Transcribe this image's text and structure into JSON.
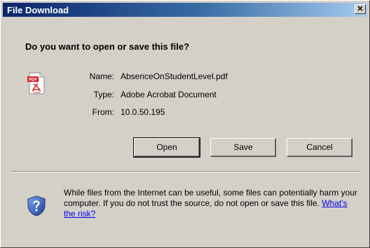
{
  "window": {
    "title": "File Download",
    "close_glyph": "✕"
  },
  "prompt": {
    "question": "Do you want to open or save this file?"
  },
  "file": {
    "icon": "pdf-file-icon",
    "icon_badge": "PDF",
    "icon_caption": "Adobe",
    "name_label": "Name:",
    "name_value": "AbsenceOnStudentLevel.pdf",
    "type_label": "Type:",
    "type_value": "Adobe Acrobat Document",
    "from_label": "From:",
    "from_value": "10.0.50.195"
  },
  "buttons": {
    "open": "Open",
    "save": "Save",
    "cancel": "Cancel"
  },
  "warning": {
    "icon": "shield-question-icon",
    "text": "While files from the Internet can be useful, some files can potentially harm your computer. If you do not trust the source, do not open or save this file.",
    "link": "What's the risk?"
  },
  "colors": {
    "title_bar": "#0a246a",
    "dialog_face": "#d4d0c8",
    "link": "#0000ee"
  }
}
